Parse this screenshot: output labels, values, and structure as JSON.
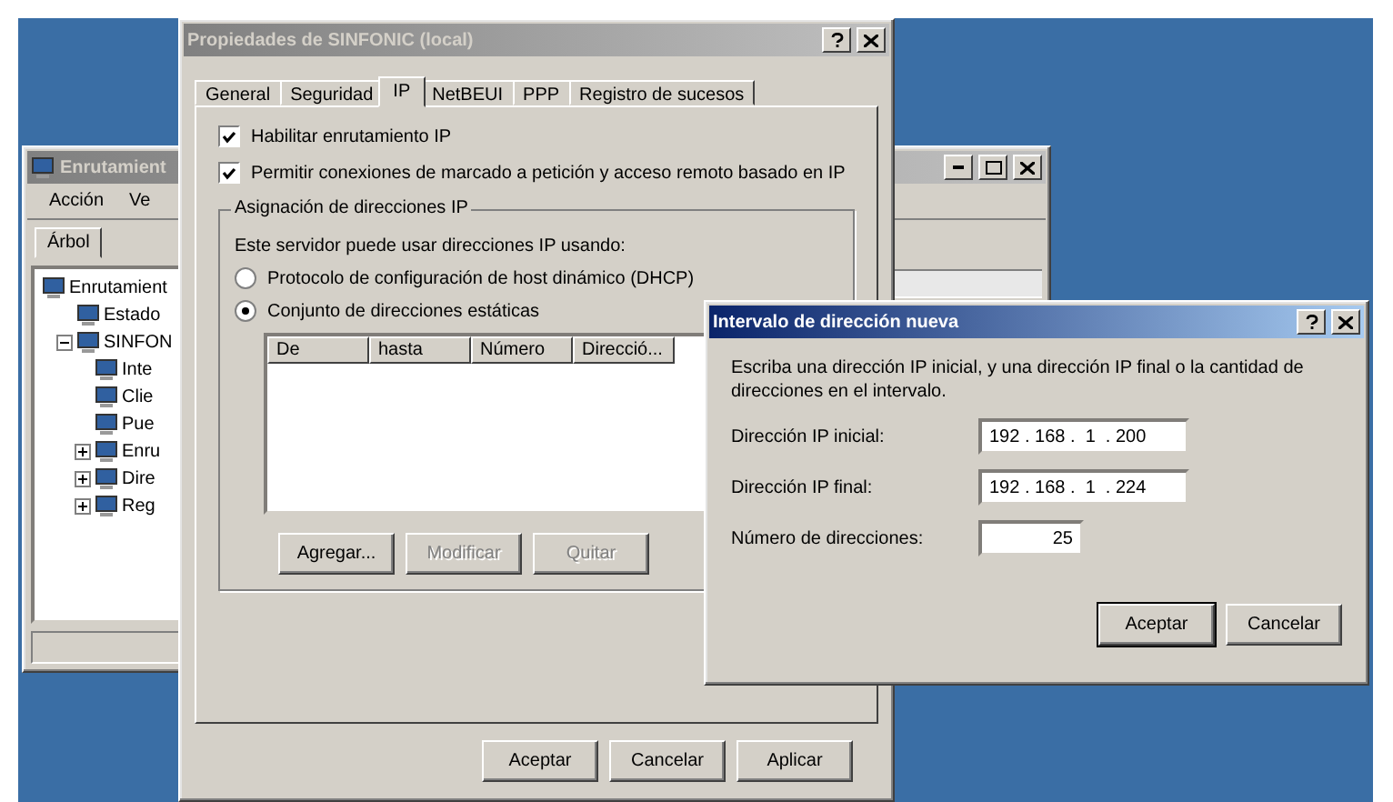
{
  "back_window": {
    "title": "Enrutamient",
    "menu": [
      "Acción",
      "Ve"
    ],
    "tab": "Árbol",
    "tree": [
      {
        "label": "Enrutamient",
        "children": [
          {
            "label": "Estado"
          },
          {
            "label": "SINFON",
            "expanded": true,
            "children": [
              {
                "label": "Inte"
              },
              {
                "label": "Clie"
              },
              {
                "label": "Pue"
              },
              {
                "label": "Enru",
                "expanded": false
              },
              {
                "label": "Dire",
                "expanded": false
              },
              {
                "label": "Reg",
                "expanded": false
              }
            ]
          }
        ]
      }
    ]
  },
  "properties_dialog": {
    "title": "Propiedades de SINFONIC (local)",
    "tabs": [
      {
        "label": "General",
        "selected": false
      },
      {
        "label": "Seguridad",
        "selected": false
      },
      {
        "label": "IP",
        "selected": true
      },
      {
        "label": "NetBEUI",
        "selected": false
      },
      {
        "label": "PPP",
        "selected": false
      },
      {
        "label": "Registro de sucesos",
        "selected": false
      }
    ],
    "checkboxes": [
      {
        "label": "Habilitar enrutamiento IP",
        "checked": true
      },
      {
        "label": "Permitir conexiones de marcado a petición y acceso remoto basado en IP",
        "checked": true
      }
    ],
    "group": {
      "title": "Asignación de direcciones IP",
      "intro": "Este servidor puede usar direcciones IP usando:",
      "radios": [
        {
          "label": "Protocolo de configuración de host dinámico (DHCP)",
          "selected": false
        },
        {
          "label": "Conjunto de direcciones estáticas",
          "selected": true
        }
      ],
      "table": {
        "columns": [
          "De",
          "hasta",
          "Número",
          "Direcció..."
        ]
      },
      "buttons": [
        {
          "label": "Agregar...",
          "disabled": false
        },
        {
          "label": "Modificar",
          "disabled": true
        },
        {
          "label": "Quitar",
          "disabled": true
        }
      ]
    },
    "buttons": [
      "Aceptar",
      "Cancelar",
      "Aplicar"
    ]
  },
  "range_dialog": {
    "title": "Intervalo de dirección nueva",
    "instructions": "Escriba una dirección IP inicial, y una dirección IP final o la cantidad de direcciones en el intervalo.",
    "fields": [
      {
        "label": "Dirección IP inicial:",
        "value": "192 . 168 .  1  . 200",
        "kind": "ip"
      },
      {
        "label": "Dirección IP final:",
        "value": "192 . 168 .  1  . 224",
        "kind": "ip"
      },
      {
        "label": "Número de direcciones:",
        "value": "25",
        "kind": "number"
      }
    ],
    "buttons": [
      "Aceptar",
      "Cancelar"
    ]
  }
}
